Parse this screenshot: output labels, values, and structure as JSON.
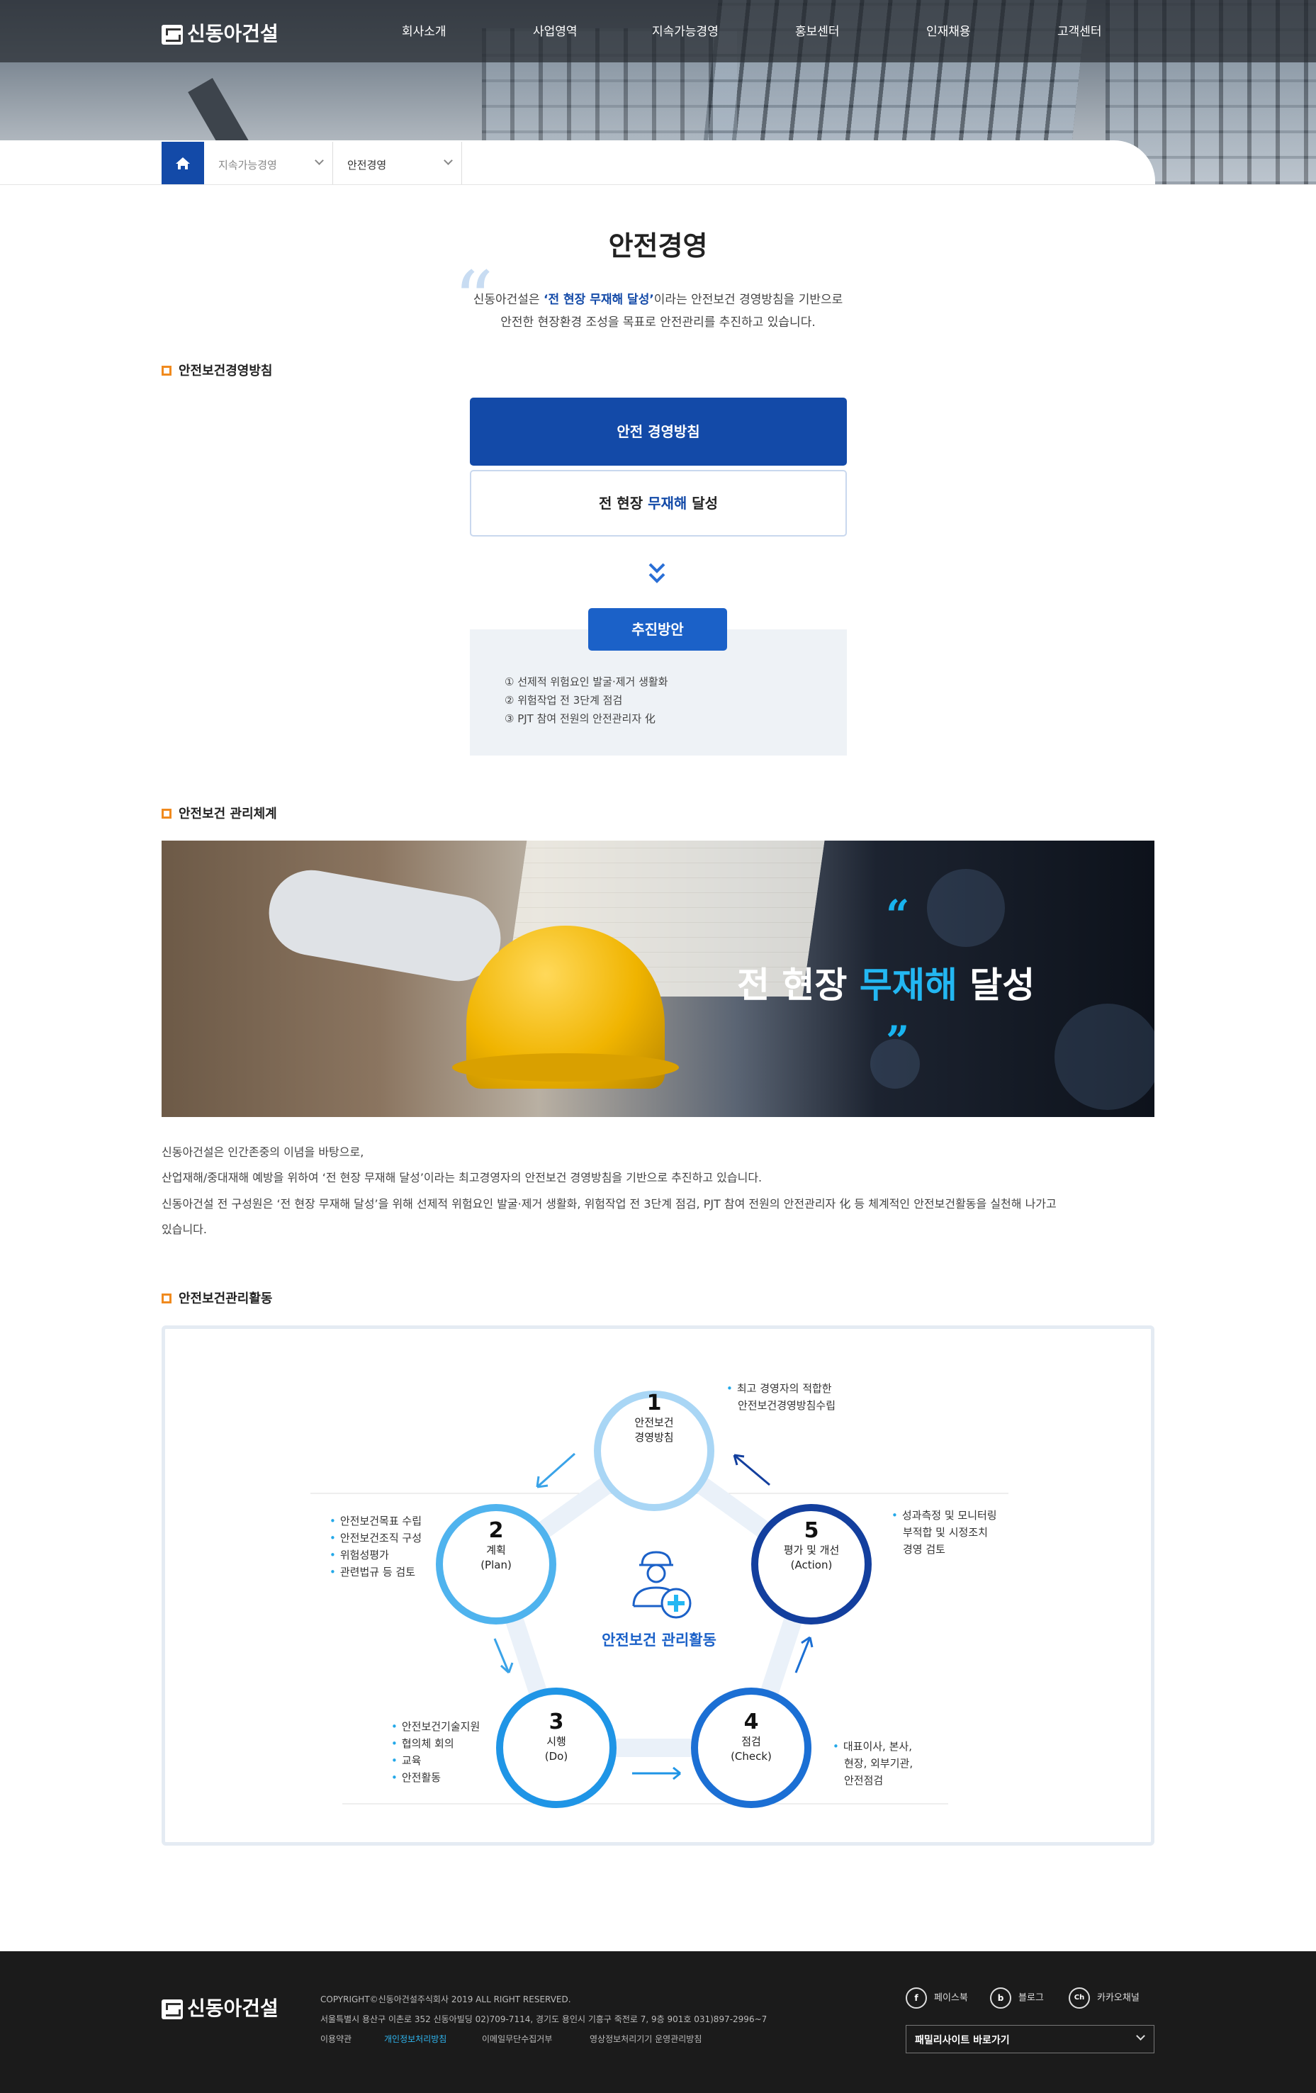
{
  "header": {
    "logo": "신동아건설",
    "nav": [
      "회사소개",
      "사업영역",
      "지속가능경영",
      "홍보센터",
      "인재채용",
      "고객센터"
    ]
  },
  "breadcrumb": {
    "level1": "지속가능경영",
    "level2": "안전경영"
  },
  "page": {
    "title": "안전경영",
    "intro_line1_prefix": "신동아건설은 ",
    "intro_line1_highlight": "‘전 현장 무재해 달성’",
    "intro_line1_suffix": "이라는 안전보건 경영방침을 기반으로",
    "intro_line2": "안전한 현장환경 조성을 목표로 안전관리를 추진하고 있습니다."
  },
  "policy": {
    "heading": "안전보건경영방침",
    "box_title": "안전 경영방침",
    "goal_prefix": "전 현장 ",
    "goal_highlight": "무재해",
    "goal_suffix": " 달성",
    "push_label": "추진방안",
    "push_items": [
      "① 선제적 위험요인 발굴·제거 생활화",
      "② 위험작업 전 3단계 점검",
      "③ PJT 참여 전원의 안전관리자 化"
    ]
  },
  "system": {
    "heading": "안전보건 관리체계",
    "banner_prefix": "전 현장 ",
    "banner_highlight": "무재해",
    "banner_suffix": " 달성",
    "paragraphs": [
      "신동아건설은 인간존중의 이념을 바탕으로,",
      "산업재해/중대재해 예방을 위하여 ‘전 현장 무재해 달성’이라는 최고경영자의 안전보건 경영방침을 기반으로 추진하고 있습니다.",
      "신동아건설 전 구성원은 ‘전 현장 무재해 달성’을 위해 선제적 위험요인 발굴·제거 생활화, 위험작업 전 3단계 점검, PJT 참여 전원의 안전관리자 化 등 체계적인 안전보건활동을 실천해 나가고",
      "있습니다."
    ]
  },
  "activity": {
    "heading": "안전보건관리활동",
    "center_title": "안전보건 관리활동",
    "steps": [
      {
        "num": "1",
        "line1": "안전보건",
        "line2": "경영방침"
      },
      {
        "num": "2",
        "line1": "계획",
        "line2": "(Plan)"
      },
      {
        "num": "3",
        "line1": "시행",
        "line2": "(Do)"
      },
      {
        "num": "4",
        "line1": "점검",
        "line2": "(Check)"
      },
      {
        "num": "5",
        "line1": "평가 및 개선",
        "line2": "(Action)"
      }
    ],
    "notes": {
      "n1": [
        "최고 경영자의 적합한",
        "안전보건경영방침수립"
      ],
      "n2": [
        "안전보건목표 수립",
        "안전보건조직 구성",
        "위험성평가",
        "관련법규 등 검토"
      ],
      "n3": [
        "안전보건기술지원",
        "협의체 회의",
        "교육",
        "안전활동"
      ],
      "n4": [
        "대표이사, 본사,",
        "현장, 외부기관,",
        "안전점검"
      ],
      "n5": [
        "성과측정 및 모니터링",
        "부적합 및 시정조치",
        "경영 검토"
      ]
    }
  },
  "footer": {
    "logo": "신동아건설",
    "copyright": "COPYRIGHT©신동아건설주식회사 2019 ALL RIGHT RESERVED.",
    "address": "서울특별시 용산구 이촌로 352 신동아빌딩 02)709-7114, 경기도 용인시 기흥구 죽전로 7, 9층 901호 031)897-2996~7",
    "links": [
      "이용약관",
      "개인정보처리방침",
      "이메일무단수집거부",
      "영상정보처리기기 운영관리방침"
    ],
    "sns": [
      {
        "icon": "f",
        "label": "페이스북"
      },
      {
        "icon": "b",
        "label": "블로그"
      },
      {
        "icon": "Ch",
        "label": "카카오채널"
      }
    ],
    "family_site": "패밀리사이트 바로가기",
    "colors": {
      "highlight_link": "#2fb6f0"
    }
  },
  "colors": {
    "brand_blue": "#134aa8",
    "accent_orange": "#f08a1e",
    "accent_cyan": "#23b7f2"
  }
}
